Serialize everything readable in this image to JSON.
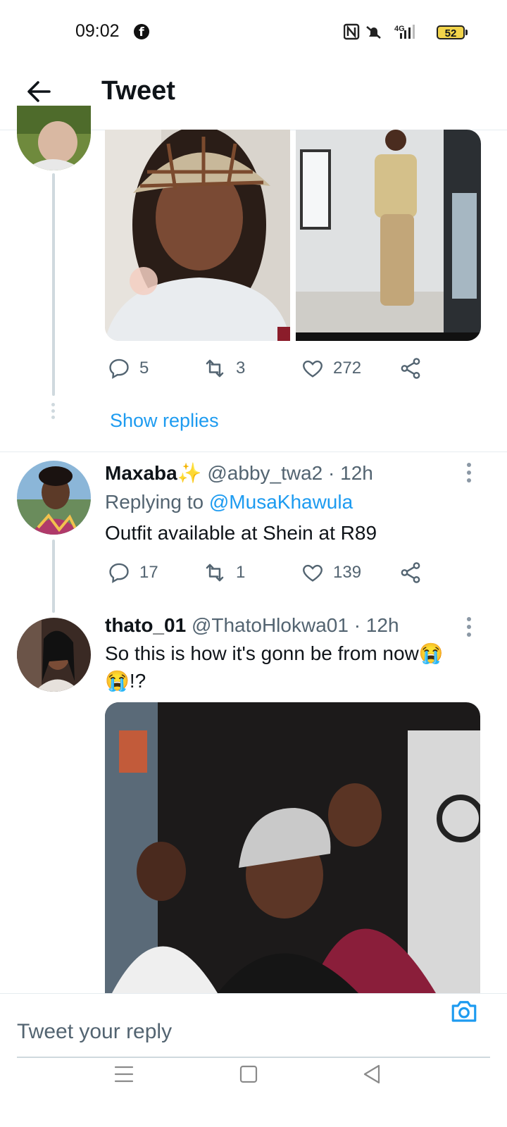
{
  "status_bar": {
    "time": "09:02",
    "battery": "52",
    "network": "4G"
  },
  "header": {
    "title": "Tweet"
  },
  "tweet1": {
    "actions": {
      "replies": "5",
      "retweets": "3",
      "likes": "272"
    },
    "show_replies": "Show replies"
  },
  "tweet2": {
    "name": "Maxaba",
    "name_emoji": "✨",
    "handle": "@abby_twa2 · 12h",
    "replying_prefix": "Replying to",
    "replying_to": "@MusaKhawula",
    "text": "Outfit available at Shein at R89",
    "actions": {
      "replies": "17",
      "retweets": "1",
      "likes": "139"
    }
  },
  "tweet3": {
    "name": "thato_01",
    "handle": "@ThatoHlokwa01 · 12h",
    "text_line1": "So this is how it's gonn be from now😭",
    "text_line2": "😭!?"
  },
  "composer": {
    "placeholder": "Tweet your reply"
  },
  "colors": {
    "accent": "#1d9bf0",
    "muted": "#536471",
    "thread": "#cfd9de"
  },
  "icons": [
    "back-arrow-icon",
    "reply-icon",
    "retweet-icon",
    "like-icon",
    "share-icon",
    "camera-icon",
    "more-icon",
    "menu-icon",
    "home-icon",
    "back-icon"
  ]
}
